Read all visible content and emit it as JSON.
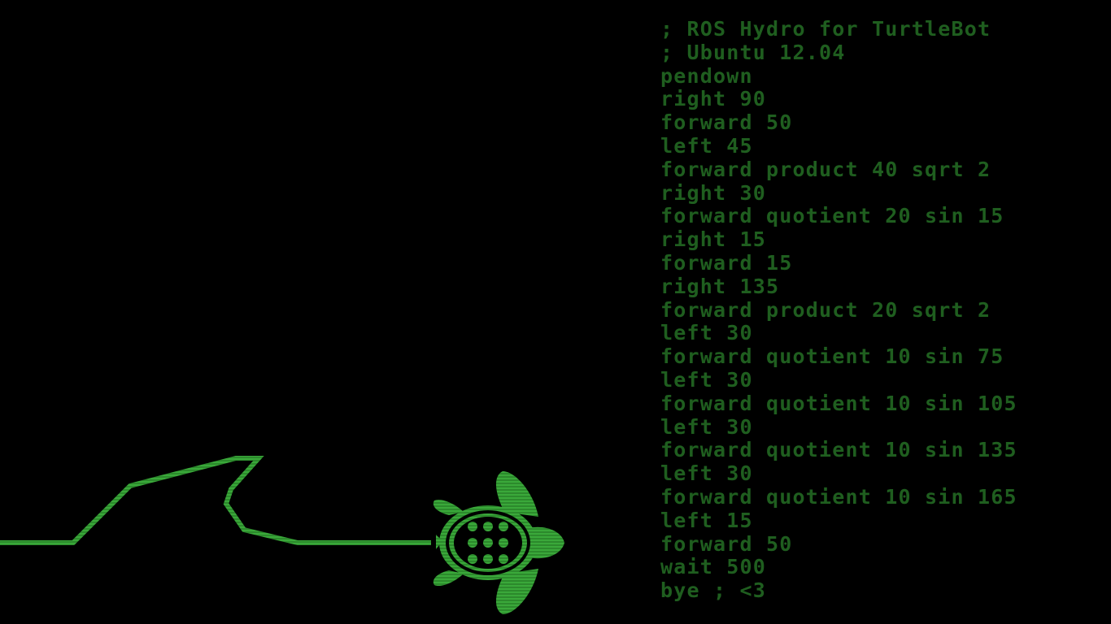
{
  "screen": {
    "background": "#000000",
    "trail_color": "#2e8b2e",
    "turtle_color": "#3aa83a",
    "code_color": "#1f5e1f"
  },
  "turtle": {
    "icon": "turtle-icon"
  },
  "program": {
    "lines": [
      "; ROS Hydro for TurtleBot",
      "; Ubuntu 12.04",
      "pendown",
      "right 90",
      "forward 50",
      "left 45",
      "forward product 40 sqrt 2",
      "right 30",
      "forward quotient 20 sin 15",
      "right 15",
      "forward 15",
      "right 135",
      "forward product 20 sqrt 2",
      "left 30",
      "forward quotient 10 sin 75",
      "left 30",
      "forward quotient 10 sin 105",
      "left 30",
      "forward quotient 10 sin 135",
      "left 30",
      "forward quotient 10 sin 165",
      "left 15",
      "forward 50",
      "wait 500",
      "bye ; <3"
    ]
  }
}
